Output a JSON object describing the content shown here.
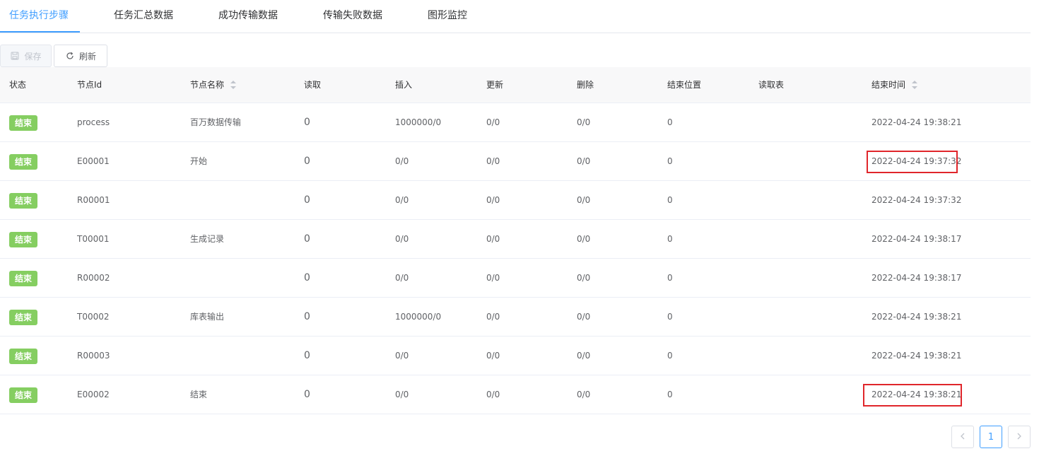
{
  "tabs": [
    {
      "label": "任务执行步骤",
      "active": true
    },
    {
      "label": "任务汇总数据",
      "active": false
    },
    {
      "label": "成功传输数据",
      "active": false
    },
    {
      "label": "传输失败数据",
      "active": false
    },
    {
      "label": "图形监控",
      "active": false
    }
  ],
  "toolbar": {
    "save_label": "保存",
    "refresh_label": "刷新"
  },
  "table": {
    "columns": [
      "状态",
      "节点Id",
      "节点名称",
      "读取",
      "插入",
      "更新",
      "删除",
      "结束位置",
      "读取表",
      "结束时间"
    ],
    "rows": [
      {
        "status": "结束",
        "id": "process",
        "name": "百万数据传输",
        "read": "0",
        "insert": "1000000/0",
        "update": "0/0",
        "delete": "0/0",
        "end_pos": "0",
        "read_table": "",
        "end_time": "2022-04-24 19:38:21"
      },
      {
        "status": "结束",
        "id": "E00001",
        "name": "开始",
        "read": "0",
        "insert": "0/0",
        "update": "0/0",
        "delete": "0/0",
        "end_pos": "0",
        "read_table": "",
        "end_time": "2022-04-24 19:37:32"
      },
      {
        "status": "结束",
        "id": "R00001",
        "name": "",
        "read": "0",
        "insert": "0/0",
        "update": "0/0",
        "delete": "0/0",
        "end_pos": "0",
        "read_table": "",
        "end_time": "2022-04-24 19:37:32"
      },
      {
        "status": "结束",
        "id": "T00001",
        "name": "生成记录",
        "read": "0",
        "insert": "0/0",
        "update": "0/0",
        "delete": "0/0",
        "end_pos": "0",
        "read_table": "",
        "end_time": "2022-04-24 19:38:17"
      },
      {
        "status": "结束",
        "id": "R00002",
        "name": "",
        "read": "0",
        "insert": "0/0",
        "update": "0/0",
        "delete": "0/0",
        "end_pos": "0",
        "read_table": "",
        "end_time": "2022-04-24 19:38:17"
      },
      {
        "status": "结束",
        "id": "T00002",
        "name": "库表输出",
        "read": "0",
        "insert": "1000000/0",
        "update": "0/0",
        "delete": "0/0",
        "end_pos": "0",
        "read_table": "",
        "end_time": "2022-04-24 19:38:21"
      },
      {
        "status": "结束",
        "id": "R00003",
        "name": "",
        "read": "0",
        "insert": "0/0",
        "update": "0/0",
        "delete": "0/0",
        "end_pos": "0",
        "read_table": "",
        "end_time": "2022-04-24 19:38:21"
      },
      {
        "status": "结束",
        "id": "E00002",
        "name": "结束",
        "read": "0",
        "insert": "0/0",
        "update": "0/0",
        "delete": "0/0",
        "end_pos": "0",
        "read_table": "",
        "end_time": "2022-04-24 19:38:21"
      }
    ]
  },
  "pagination": {
    "current_page": "1",
    "prev_icon": "chevron-left-icon",
    "next_icon": "chevron-right-icon"
  },
  "colors": {
    "accent": "#409eff",
    "status_tag": "#85ce61",
    "highlight_box": "#e0262b"
  }
}
